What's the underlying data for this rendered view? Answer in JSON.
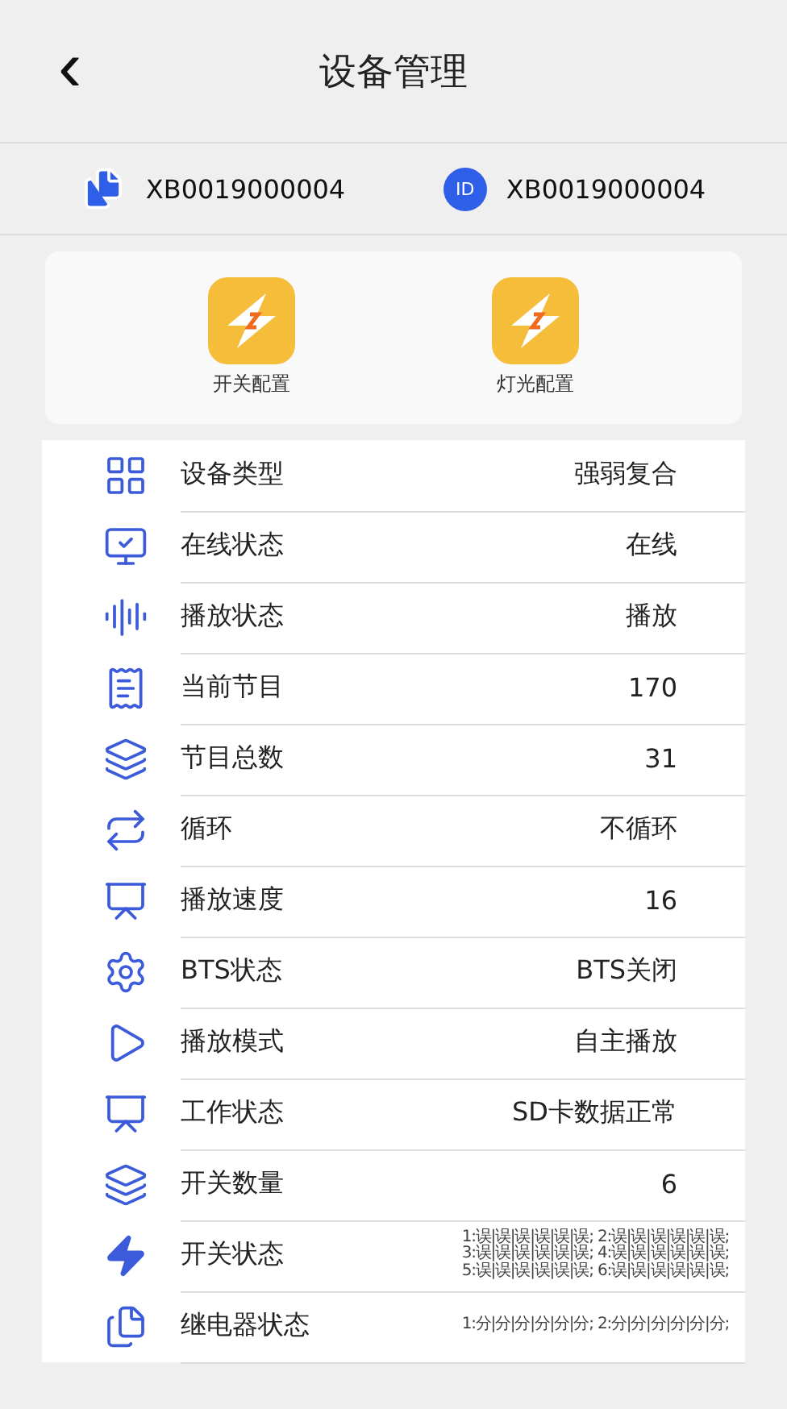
{
  "header": {
    "back": "‹",
    "title": "设备管理"
  },
  "ids": [
    {
      "kind": "doc",
      "value": "XB0019000004"
    },
    {
      "kind": "id",
      "badge": "ID",
      "value": "XB0019000004"
    }
  ],
  "actions": [
    {
      "label": "开关配置"
    },
    {
      "label": "灯光配置"
    }
  ],
  "rows": [
    {
      "label": "设备类型",
      "value": "强弱复合"
    },
    {
      "label": "在线状态",
      "value": "在线"
    },
    {
      "label": "播放状态",
      "value": "播放"
    },
    {
      "label": "当前节目",
      "value": "170"
    },
    {
      "label": "节目总数",
      "value": "31"
    },
    {
      "label": "循环",
      "value": "不循环"
    },
    {
      "label": "播放速度",
      "value": "16"
    },
    {
      "label": "BTS状态",
      "value": "BTS关闭"
    },
    {
      "label": "播放模式",
      "value": "自主播放"
    },
    {
      "label": "工作状态",
      "value": "SD卡数据正常"
    },
    {
      "label": "开关数量",
      "value": "6"
    },
    {
      "label": "开关状态",
      "lines": [
        "1:误|误|误|误|误|误; 2:误|误|误|误|误|误;",
        "3:误|误|误|误|误|误; 4:误|误|误|误|误|误;",
        "5:误|误|误|误|误|误; 6:误|误|误|误|误|误;"
      ]
    },
    {
      "label": "继电器状态",
      "lines": [
        "1:分|分|分|分|分|分; 2:分|分|分|分|分|分;"
      ]
    }
  ]
}
